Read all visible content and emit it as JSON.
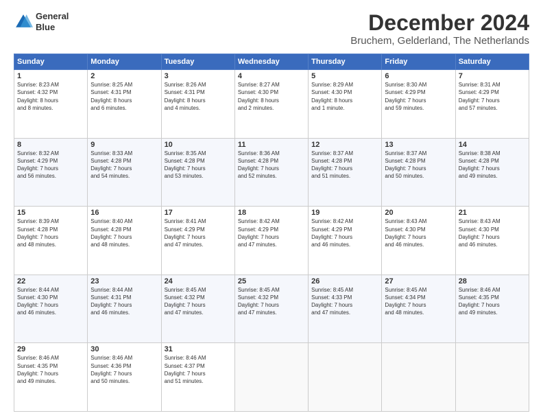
{
  "header": {
    "logo_line1": "General",
    "logo_line2": "Blue",
    "title": "December 2024",
    "subtitle": "Bruchem, Gelderland, The Netherlands"
  },
  "weekdays": [
    "Sunday",
    "Monday",
    "Tuesday",
    "Wednesday",
    "Thursday",
    "Friday",
    "Saturday"
  ],
  "weeks": [
    [
      {
        "day": "1",
        "info": "Sunrise: 8:23 AM\nSunset: 4:32 PM\nDaylight: 8 hours\nand 8 minutes."
      },
      {
        "day": "2",
        "info": "Sunrise: 8:25 AM\nSunset: 4:31 PM\nDaylight: 8 hours\nand 6 minutes."
      },
      {
        "day": "3",
        "info": "Sunrise: 8:26 AM\nSunset: 4:31 PM\nDaylight: 8 hours\nand 4 minutes."
      },
      {
        "day": "4",
        "info": "Sunrise: 8:27 AM\nSunset: 4:30 PM\nDaylight: 8 hours\nand 2 minutes."
      },
      {
        "day": "5",
        "info": "Sunrise: 8:29 AM\nSunset: 4:30 PM\nDaylight: 8 hours\nand 1 minute."
      },
      {
        "day": "6",
        "info": "Sunrise: 8:30 AM\nSunset: 4:29 PM\nDaylight: 7 hours\nand 59 minutes."
      },
      {
        "day": "7",
        "info": "Sunrise: 8:31 AM\nSunset: 4:29 PM\nDaylight: 7 hours\nand 57 minutes."
      }
    ],
    [
      {
        "day": "8",
        "info": "Sunrise: 8:32 AM\nSunset: 4:29 PM\nDaylight: 7 hours\nand 56 minutes."
      },
      {
        "day": "9",
        "info": "Sunrise: 8:33 AM\nSunset: 4:28 PM\nDaylight: 7 hours\nand 54 minutes."
      },
      {
        "day": "10",
        "info": "Sunrise: 8:35 AM\nSunset: 4:28 PM\nDaylight: 7 hours\nand 53 minutes."
      },
      {
        "day": "11",
        "info": "Sunrise: 8:36 AM\nSunset: 4:28 PM\nDaylight: 7 hours\nand 52 minutes."
      },
      {
        "day": "12",
        "info": "Sunrise: 8:37 AM\nSunset: 4:28 PM\nDaylight: 7 hours\nand 51 minutes."
      },
      {
        "day": "13",
        "info": "Sunrise: 8:37 AM\nSunset: 4:28 PM\nDaylight: 7 hours\nand 50 minutes."
      },
      {
        "day": "14",
        "info": "Sunrise: 8:38 AM\nSunset: 4:28 PM\nDaylight: 7 hours\nand 49 minutes."
      }
    ],
    [
      {
        "day": "15",
        "info": "Sunrise: 8:39 AM\nSunset: 4:28 PM\nDaylight: 7 hours\nand 48 minutes."
      },
      {
        "day": "16",
        "info": "Sunrise: 8:40 AM\nSunset: 4:28 PM\nDaylight: 7 hours\nand 48 minutes."
      },
      {
        "day": "17",
        "info": "Sunrise: 8:41 AM\nSunset: 4:29 PM\nDaylight: 7 hours\nand 47 minutes."
      },
      {
        "day": "18",
        "info": "Sunrise: 8:42 AM\nSunset: 4:29 PM\nDaylight: 7 hours\nand 47 minutes."
      },
      {
        "day": "19",
        "info": "Sunrise: 8:42 AM\nSunset: 4:29 PM\nDaylight: 7 hours\nand 46 minutes."
      },
      {
        "day": "20",
        "info": "Sunrise: 8:43 AM\nSunset: 4:30 PM\nDaylight: 7 hours\nand 46 minutes."
      },
      {
        "day": "21",
        "info": "Sunrise: 8:43 AM\nSunset: 4:30 PM\nDaylight: 7 hours\nand 46 minutes."
      }
    ],
    [
      {
        "day": "22",
        "info": "Sunrise: 8:44 AM\nSunset: 4:30 PM\nDaylight: 7 hours\nand 46 minutes."
      },
      {
        "day": "23",
        "info": "Sunrise: 8:44 AM\nSunset: 4:31 PM\nDaylight: 7 hours\nand 46 minutes."
      },
      {
        "day": "24",
        "info": "Sunrise: 8:45 AM\nSunset: 4:32 PM\nDaylight: 7 hours\nand 47 minutes."
      },
      {
        "day": "25",
        "info": "Sunrise: 8:45 AM\nSunset: 4:32 PM\nDaylight: 7 hours\nand 47 minutes."
      },
      {
        "day": "26",
        "info": "Sunrise: 8:45 AM\nSunset: 4:33 PM\nDaylight: 7 hours\nand 47 minutes."
      },
      {
        "day": "27",
        "info": "Sunrise: 8:45 AM\nSunset: 4:34 PM\nDaylight: 7 hours\nand 48 minutes."
      },
      {
        "day": "28",
        "info": "Sunrise: 8:46 AM\nSunset: 4:35 PM\nDaylight: 7 hours\nand 49 minutes."
      }
    ],
    [
      {
        "day": "29",
        "info": "Sunrise: 8:46 AM\nSunset: 4:35 PM\nDaylight: 7 hours\nand 49 minutes."
      },
      {
        "day": "30",
        "info": "Sunrise: 8:46 AM\nSunset: 4:36 PM\nDaylight: 7 hours\nand 50 minutes."
      },
      {
        "day": "31",
        "info": "Sunrise: 8:46 AM\nSunset: 4:37 PM\nDaylight: 7 hours\nand 51 minutes."
      },
      null,
      null,
      null,
      null
    ]
  ]
}
